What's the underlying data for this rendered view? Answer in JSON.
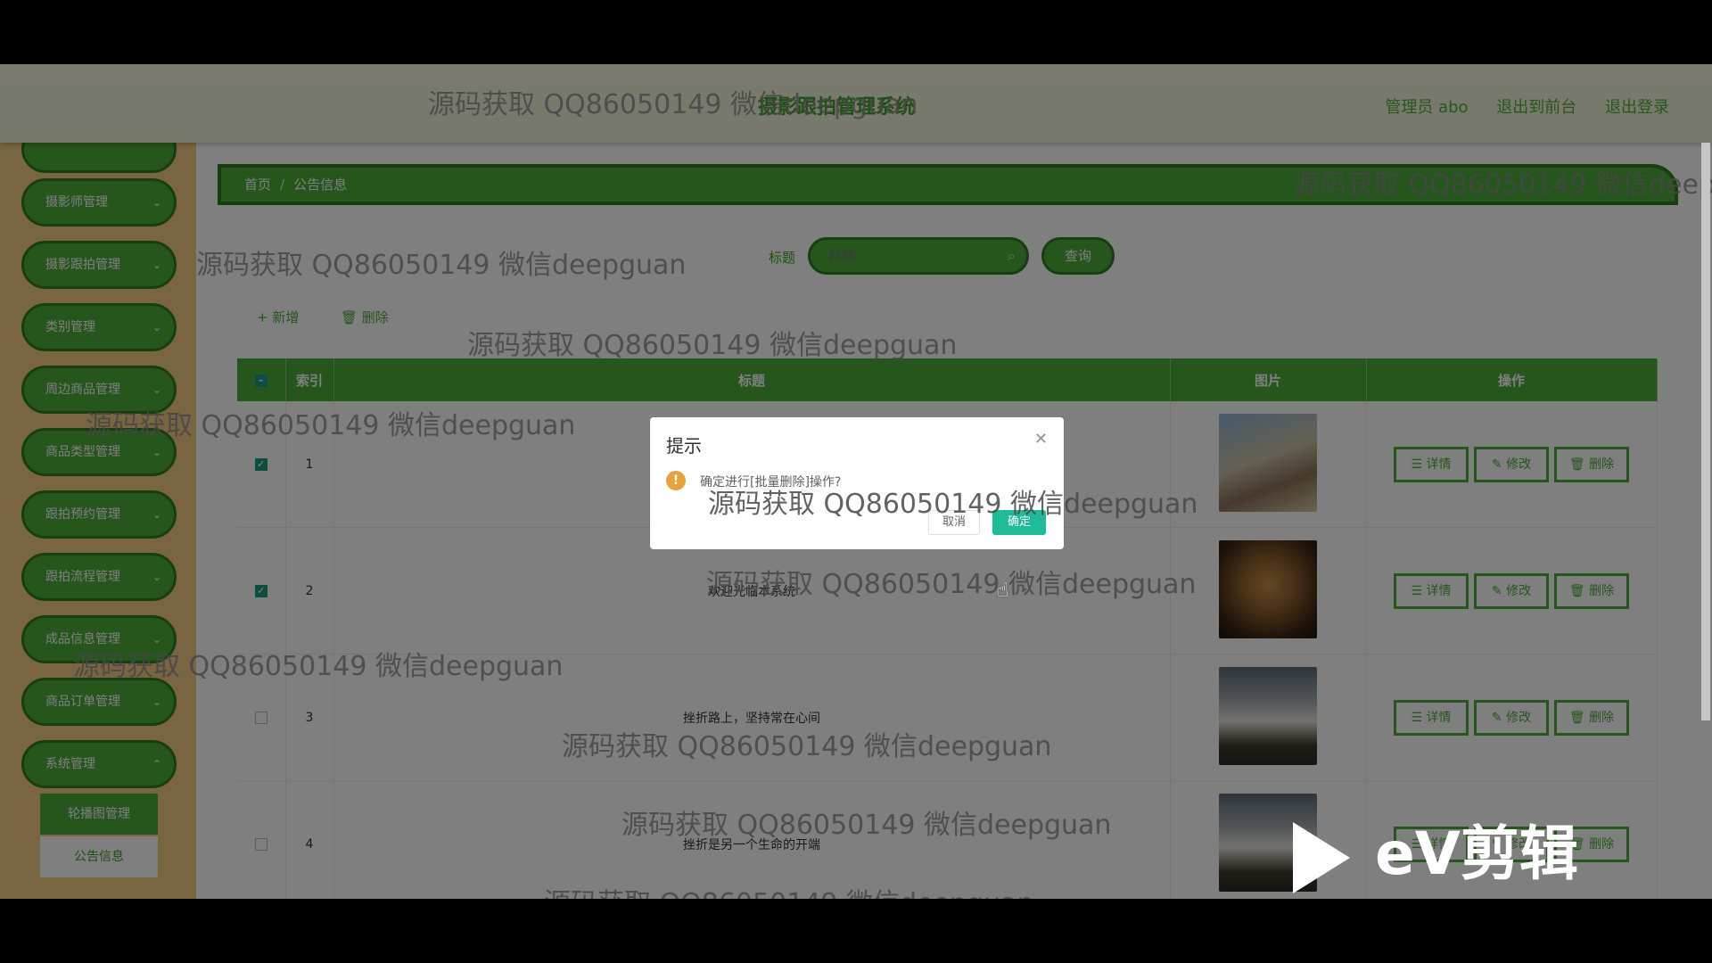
{
  "watermark": "源码获取 QQ86050149 微信deepguan",
  "header": {
    "title": "摄影跟拍管理系统",
    "admin": "管理员 abo",
    "to_front": "退出到前台",
    "logout": "退出登录"
  },
  "sidebar": {
    "items": [
      {
        "label": ""
      },
      {
        "label": "摄影师管理"
      },
      {
        "label": "摄影跟拍管理"
      },
      {
        "label": "类别管理"
      },
      {
        "label": "周边商品管理"
      },
      {
        "label": "商品类型管理"
      },
      {
        "label": "跟拍预约管理"
      },
      {
        "label": "跟拍流程管理"
      },
      {
        "label": "成品信息管理"
      },
      {
        "label": "商品订单管理"
      },
      {
        "label": "系统管理"
      }
    ],
    "submenu": [
      {
        "label": "轮播图管理"
      },
      {
        "label": "公告信息"
      }
    ]
  },
  "breadcrumb": {
    "home": "首页",
    "sep": "/",
    "current": "公告信息"
  },
  "search": {
    "label": "标题",
    "placeholder": "标题",
    "button": "查询"
  },
  "toolbar": {
    "add": "+ 新增",
    "delete": "🗑 删除"
  },
  "table": {
    "headers": {
      "index": "索引",
      "title": "标题",
      "image": "图片",
      "ops": "操作"
    },
    "rows": [
      {
        "index": "1",
        "title": "",
        "checked": true
      },
      {
        "index": "2",
        "title": "欢迎光临本系统",
        "checked": true
      },
      {
        "index": "3",
        "title": "挫折路上，坚持常在心间",
        "checked": false
      },
      {
        "index": "4",
        "title": "挫折是另一个生命的开端",
        "checked": false
      }
    ],
    "ops": {
      "detail": "详情",
      "edit": "修改",
      "delete": "删除"
    }
  },
  "dialog": {
    "title": "提示",
    "message": "确定进行[批量删除]操作?",
    "cancel": "取消",
    "confirm": "确定"
  },
  "ev_logo": "eV剪辑",
  "colors": {
    "primary": "#4eaa3c",
    "border": "#2f7a22",
    "sidebar": "#f2cb85",
    "confirm": "#1fba9a"
  }
}
